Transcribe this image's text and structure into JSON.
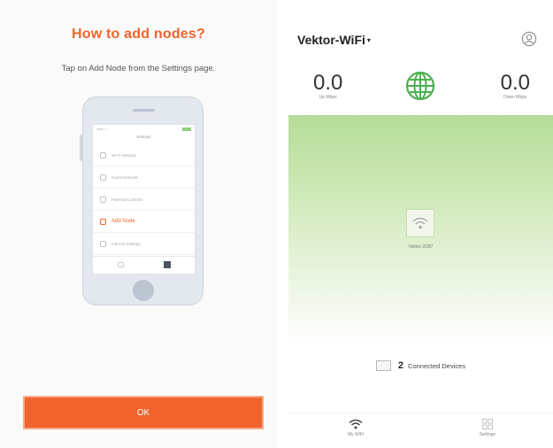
{
  "left": {
    "title": "How to add nodes?",
    "subtitle": "Tap on Add Node from the Settings page.",
    "phone": {
      "status_carrier": "●●●○○",
      "header": "Settings",
      "items": [
        {
          "label": "Wi-Fi Settings",
          "highlight": false
        },
        {
          "label": "Guest Network",
          "highlight": false
        },
        {
          "label": "Parental Controls",
          "highlight": false
        },
        {
          "label": "Add Node",
          "highlight": true
        },
        {
          "label": "Internet Settings",
          "highlight": false
        }
      ]
    },
    "ok_label": "OK"
  },
  "right": {
    "network_name": "Vektor-WiFi",
    "caret": "▾",
    "up_speed": "0.0",
    "up_label": "Up Mbps",
    "down_speed": "0.0",
    "down_label": "Down Mbps",
    "node_name": "Vektor-2D87",
    "connected_count": "2",
    "connected_label": "Connected Devices",
    "nav": [
      {
        "label": "My WiFi",
        "icon": "wifi-icon"
      },
      {
        "label": "Settings",
        "icon": "settings-grid-icon"
      }
    ],
    "colors": {
      "accent": "#f0632d",
      "green": "#4caf50",
      "gradient_top": "#b6dd98"
    }
  }
}
